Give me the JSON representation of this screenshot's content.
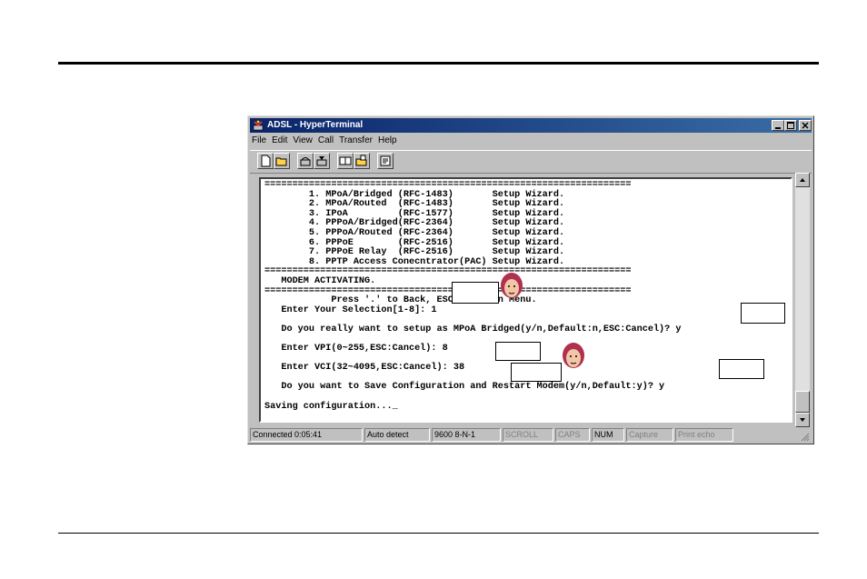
{
  "window": {
    "title": "ADSL - HyperTerminal",
    "menu": [
      {
        "label": "File",
        "key": "F"
      },
      {
        "label": "Edit",
        "key": "E"
      },
      {
        "label": "View",
        "key": "V"
      },
      {
        "label": "Call",
        "key": "C"
      },
      {
        "label": "Transfer",
        "key": "T"
      },
      {
        "label": "Help",
        "key": "H"
      }
    ],
    "toolbar_icons": [
      "new-icon",
      "open-icon",
      "connect-icon",
      "disconnect-icon",
      "send-icon",
      "receive-icon",
      "properties-icon"
    ]
  },
  "terminal": {
    "lines": [
      "==================================================================",
      "        1. MPoA/Bridged (RFC-1483)       Setup Wizard.",
      "        2. MPoA/Routed  (RFC-1483)       Setup Wizard.",
      "        3. IPoA         (RFC-1577)       Setup Wizard.",
      "        4. PPPoA/Bridged(RFC-2364)       Setup Wizard.",
      "        5. PPPoA/Routed (RFC-2364)       Setup Wizard.",
      "        6. PPPoE        (RFC-2516)       Setup Wizard.",
      "        7. PPPoE Relay  (RFC-2516)       Setup Wizard.",
      "        8. PPTP Access Conecntrator(PAC) Setup Wizard.",
      "==================================================================",
      "   MODEM ACTIVATING.",
      "==================================================================",
      "            Press '.' to Back, ESC' to Main Menu.",
      "   Enter Your Selection[1-8]: 1",
      "",
      "   Do you really want to setup as MPoA Bridged(y/n,Default:n,ESC:Cancel)? y",
      "",
      "   Enter VPI(0~255,ESC:Cancel): 8",
      "",
      "   Enter VCI(32~4095,ESC:Cancel): 38",
      "",
      "   Do you want to Save Configuration and Restart Modem(y/n,Default:y)? y",
      "",
      "Saving configuration..._"
    ]
  },
  "statusbar": {
    "connected": "Connected 0:05:41",
    "detect": "Auto detect",
    "settings": "9600 8-N-1",
    "scroll": "SCROLL",
    "caps": "CAPS",
    "num": "NUM",
    "capture": "Capture",
    "print_echo": "Print echo"
  },
  "colors": {
    "titlebar_start": "#0a246a",
    "titlebar_end": "#3a6ea5",
    "window_face": "#c0c0c0"
  }
}
